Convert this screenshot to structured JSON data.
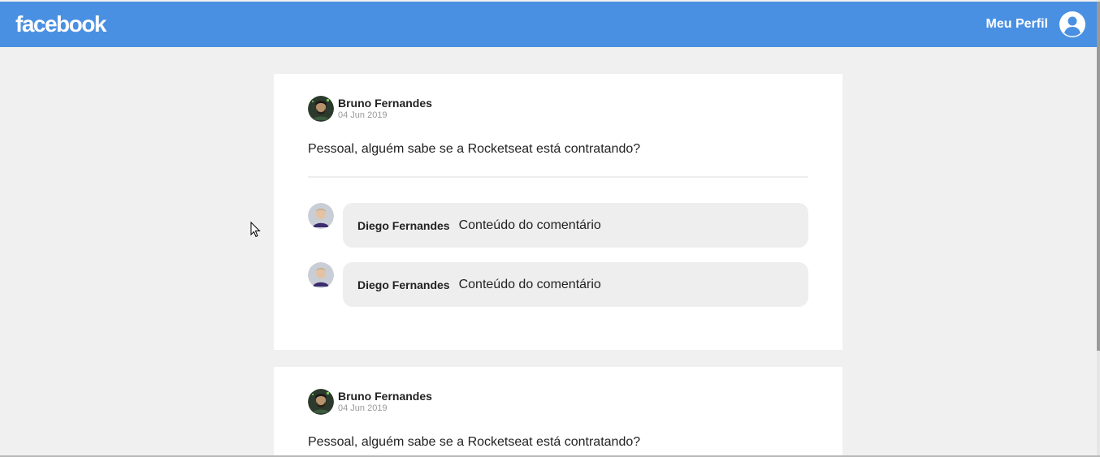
{
  "header": {
    "logo": "facebook",
    "profile_label": "Meu Perfil",
    "brand_color": "#4a90e2",
    "profile_icon": "user-circle-icon"
  },
  "posts": [
    {
      "author": "Bruno Fernandes",
      "date": "04 Jun 2019",
      "content": "Pessoal, alguém sabe se a Rocketseat está contratando?",
      "comments": [
        {
          "author": "Diego Fernandes",
          "content": "Conteúdo do comentário"
        },
        {
          "author": "Diego Fernandes",
          "content": "Conteúdo do comentário"
        }
      ]
    },
    {
      "author": "Bruno Fernandes",
      "date": "04 Jun 2019",
      "content": "Pessoal, alguém sabe se a Rocketseat está contratando?",
      "comments": []
    }
  ]
}
